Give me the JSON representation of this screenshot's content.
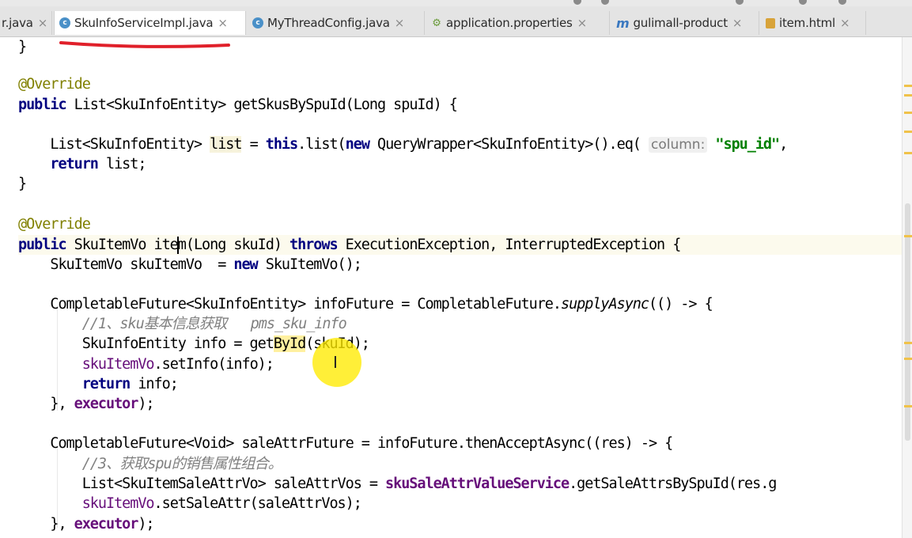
{
  "tabs": [
    {
      "label": "r.java",
      "icon": "none",
      "active": false
    },
    {
      "label": "SkuInfoServiceImpl.java",
      "icon": "class-icon",
      "active": true
    },
    {
      "label": "MyThreadConfig.java",
      "icon": "class-icon",
      "active": false
    },
    {
      "label": "application.properties",
      "icon": "properties-file-icon",
      "active": false
    },
    {
      "label": "gulimall-product",
      "icon": "maven-module-icon",
      "active": false
    },
    {
      "label": "item.html",
      "icon": "html-file-icon",
      "active": false
    }
  ],
  "tab_close_glyph": "×",
  "annotation": {
    "color": "#e0202a",
    "marks": "red underline under active tab"
  },
  "code": {
    "l1": {
      "t1": "}"
    },
    "l2": {
      "t1": "@Override"
    },
    "l3": {
      "t1": "public",
      "t2": " List<SkuInfoEntity> getSkusBySpuId(Long spuId) {"
    },
    "l4": {
      "t1": "    List<SkuInfoEntity> ",
      "t2": "list",
      "t3": " = ",
      "t4": "this",
      "t5": ".list(",
      "t6": "new",
      "t7": " QueryWrapper<SkuInfoEntity>().eq( ",
      "hint": "column:",
      "t8": " ",
      "str": "\"spu_id\"",
      "t9": ","
    },
    "l5": {
      "t1": "    ",
      "t2": "return",
      "t3": " list;"
    },
    "l6": {
      "t1": "}"
    },
    "l7": {
      "t1": "@Override"
    },
    "l8": {
      "t1": "public",
      "t2": " SkuItemVo ",
      "t3": "item(Long skuId) ",
      "t4": "throws",
      "t5": " ExecutionException, InterruptedException {"
    },
    "l9": {
      "t1": "    SkuItemVo skuItemVo  = ",
      "t2": "new",
      "t3": " SkuItemVo();"
    },
    "l10": {
      "t1": "    CompletableFuture<SkuInfoEntity> infoFuture = CompletableFuture.",
      "t2": "supplyAsync",
      "t3": "(() -> {"
    },
    "l11": {
      "t1": "        //1、sku基本信息获取   pms_sku_info"
    },
    "l12": {
      "t1": "        SkuInfoEntity info = get",
      "t2": "ById",
      "t3": "(skuId);"
    },
    "l13": {
      "t1": "        ",
      "t2": "skuItemVo",
      "t3": ".setInfo(info);"
    },
    "l14": {
      "t1": "        ",
      "t2": "return",
      "t3": " info;"
    },
    "l15": {
      "t1": "    }, ",
      "t2": "executor",
      "t3": ");"
    },
    "l16": {
      "t1": "    CompletableFuture<Void> saleAttrFuture = infoFuture.thenAcceptAsync((res) -> {"
    },
    "l17": {
      "t1": "        //3、获取spu的销售属性组合。"
    },
    "l18": {
      "t1": "        List<SkuItemSaleAttrVo> saleAttrVos = ",
      "t2": "skuSaleAttrValueService",
      "t3": ".getSaleAttrsBySpuId(res.g"
    },
    "l19": {
      "t1": "        ",
      "t2": "skuItemVo",
      "t3": ".setSaleAttr(saleAttrVos);"
    },
    "l20": {
      "t1": "    }, ",
      "t2": "executor",
      "t3": ");"
    }
  },
  "colors": {
    "keyword": "#000080",
    "annotation": "#808000",
    "comment": "#808080",
    "field": "#660e7a",
    "string": "#008000",
    "cursor_highlight": "#ffeb00"
  },
  "mouse_cursor": {
    "glyph": "I"
  }
}
